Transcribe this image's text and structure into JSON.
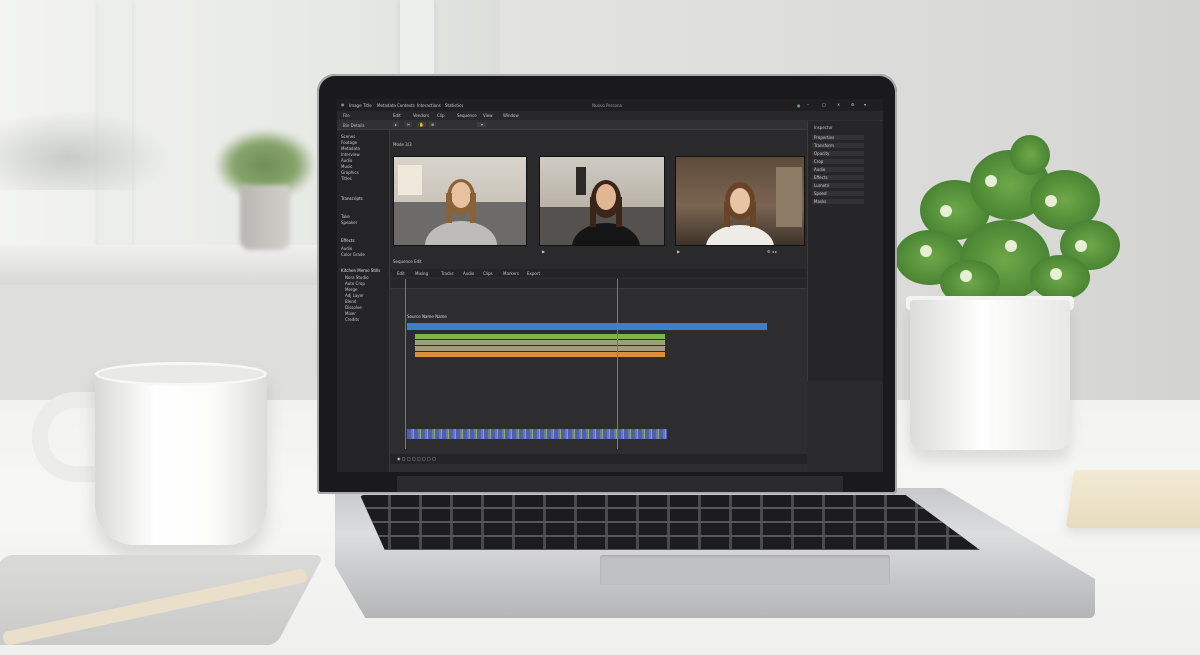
{
  "editor": {
    "titlebar": [
      "Image",
      "Title",
      "Metadata",
      "Contexts",
      "Interactions",
      "Statistics"
    ],
    "window_title": "Nuovo Persona",
    "menu": [
      "File",
      "Edit",
      "Vendors",
      "Clip",
      "Sequence",
      "View",
      "Window"
    ],
    "left_panel": {
      "heading": "Bin Details",
      "items": [
        "Scenes",
        "Footage",
        "Metadata",
        "Interview",
        "Audio",
        "Music",
        "Graphics",
        "Titles"
      ],
      "section2": "Transcripts",
      "section2_items": [
        "Take",
        "Speaker"
      ],
      "section3": "Effects",
      "section3_items": [
        "Audio",
        "Color Grade"
      ],
      "section4": "Kitchen Memo Stills",
      "section4_items": [
        "Nora Studio",
        "Auto Crop",
        "Merge",
        "Adj Layer",
        "Blend",
        "Dissolve",
        "Mixer",
        "Credits"
      ]
    },
    "preview_label": "Mode 3/3",
    "timeline_label": "Sequence Edit",
    "timeline_tabs": [
      "Edit",
      "Mixing",
      "Tracks",
      "Audio",
      "Clips",
      "Markers",
      "Export"
    ],
    "track_label": "Source Name Name",
    "right_panel": [
      "Inspector",
      "Properties",
      "Transform",
      "Opacity",
      "Crop",
      "Audio",
      "Effects",
      "Lumetri",
      "Speed",
      "Masks"
    ],
    "colors": {
      "accent_blue": "#3d7fc8",
      "track_green": "#7ab648",
      "track_orange": "#d9913a",
      "playhead": "#2ea84a"
    }
  }
}
